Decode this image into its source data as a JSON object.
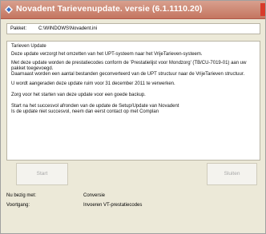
{
  "window": {
    "title": "Novadent Tarievenupdate. versie (6.1.1110.20)"
  },
  "package": {
    "label": "Pakket:",
    "path": "C:\\WINDOWS\\Novadent.ini"
  },
  "info": {
    "heading": "Tarieven Update",
    "line1": "Deze update verzorgt het omzetten van het UPT-systeem naar het VrijeTarieven-systeem.",
    "line2a": "Met deze update worden de prestatiecodes conform de 'Prestatielijst voor Mondzorg' (TB/CU-7019-01) aan uw",
    "line2b": "pakket toegevoegd.",
    "line2c": "Daarnaast worden een aantal bestanden geconverteerd van de UPT structuur naar de VrijeTarieven structuur.",
    "line3": "U wordt aangeraden deze update ruim voor 31 december 2011 te verwerken.",
    "line4": "Zorg voor het starten van deze update voor een goede backup.",
    "line5a": "Start na het succesvol afronden van de update de Setup/Update van Novadent",
    "line5b": "Is de update niet succesvol, neem dan eerst contact op met Complan"
  },
  "buttons": {
    "start": "Start",
    "close": "Sluiten"
  },
  "status": {
    "busy_label": "Nu bezig met:",
    "busy_value": "Conversie",
    "progress_label": "Voortgang:",
    "progress_value": "Invoeren VT-prestatiecodes"
  }
}
